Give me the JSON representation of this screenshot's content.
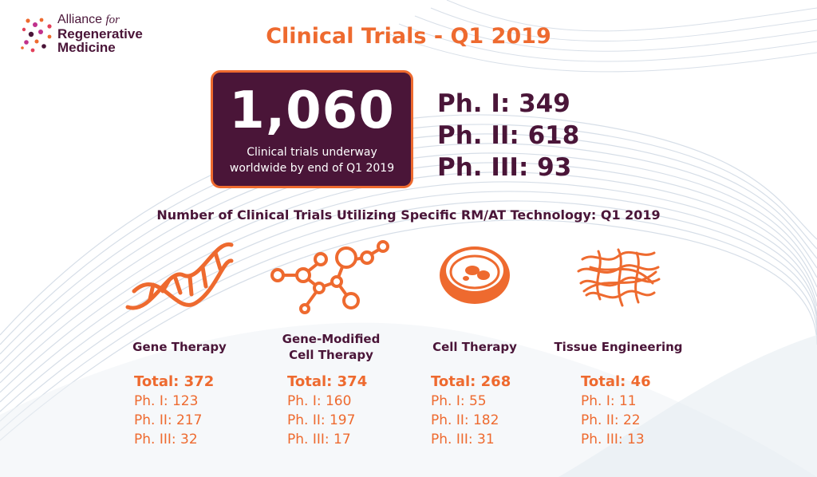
{
  "logo": {
    "line1": "Alliance",
    "line1_italic": "for",
    "line2": "Regenerative",
    "line3": "Medicine",
    "icon": "dots-logo-icon"
  },
  "title": "Clinical Trials - Q1 2019",
  "total": {
    "number": "1,060",
    "caption_line1": "Clinical trials underway",
    "caption_line2": "worldwide by end of Q1 2019"
  },
  "phases": {
    "p1": "Ph. I: 349",
    "p2": "Ph. II: 618",
    "p3": "Ph. III: 93"
  },
  "subtitle": "Number of Clinical Trials Utilizing Specific RM/AT Technology: Q1 2019",
  "technologies": [
    {
      "icon": "dna-icon",
      "name": "Gene Therapy",
      "total": "Total: 372",
      "p1": "Ph. I: 123",
      "p2": "Ph. II: 217",
      "p3": "Ph. III: 32"
    },
    {
      "icon": "molecule-icon",
      "name": "Gene-Modified Cell Therapy",
      "total": "Total: 374",
      "p1": "Ph. I: 160",
      "p2": "Ph. II: 197",
      "p3": "Ph. III: 17"
    },
    {
      "icon": "petri-dish-icon",
      "name": "Cell Therapy",
      "total": "Total: 268",
      "p1": "Ph. I: 55",
      "p2": "Ph. II: 182",
      "p3": "Ph. III: 31"
    },
    {
      "icon": "tissue-fibers-icon",
      "name": "Tissue Engineering",
      "total": "Total: 46",
      "p1": "Ph. I: 11",
      "p2": "Ph. II: 22",
      "p3": "Ph. III: 13"
    }
  ],
  "colors": {
    "accent": "#ee6a2f",
    "brand": "#4a1538"
  }
}
